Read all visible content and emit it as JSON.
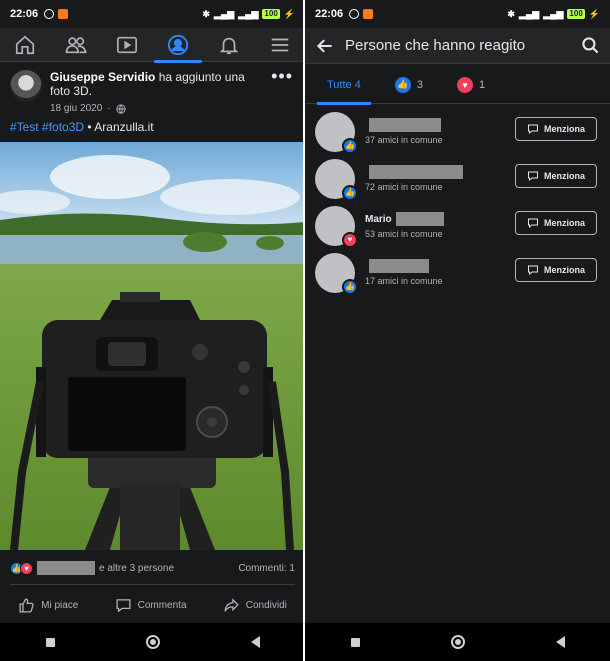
{
  "status_bar": {
    "time": "22:06",
    "battery": "100"
  },
  "post": {
    "author": "Giuseppe Servidio",
    "action": "ha aggiunto una foto 3D.",
    "date": "18 giu 2020",
    "privacy_separator": "·",
    "more_label": "•••",
    "hashtags": "#Test #foto3D",
    "separator": "•",
    "site": "Aranzulla.it",
    "reactions_text": "e altre 3 persone",
    "comments": "Commenti: 1",
    "actions": {
      "like": "Mi piace",
      "comment": "Commenta",
      "share": "Condividi"
    }
  },
  "reactions_screen": {
    "title": "Persone che hanno reagito",
    "tabs": [
      {
        "label": "Tutte 4"
      },
      {
        "label": "3"
      },
      {
        "label": "1"
      }
    ],
    "people": [
      {
        "name": "",
        "mutual": "37 amici in comune",
        "reaction": "like"
      },
      {
        "name": "",
        "mutual": "72 amici in comune",
        "reaction": "like"
      },
      {
        "name": "Mario",
        "mutual": "53 amici in comune",
        "reaction": "love"
      },
      {
        "name": "",
        "mutual": "17 amici in comune",
        "reaction": "like"
      }
    ],
    "mention_label": "Menziona"
  },
  "colors": {
    "accent": "#2d88ff",
    "like": "#1877f2",
    "love": "#f33e58",
    "background": "#18191a"
  }
}
